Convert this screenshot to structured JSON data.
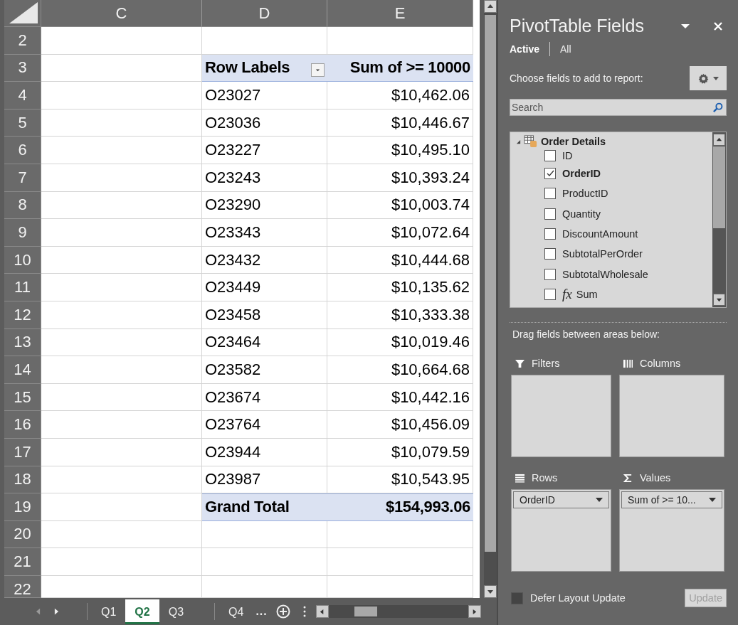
{
  "sheet": {
    "columns": [
      "C",
      "D",
      "E"
    ],
    "rows": [
      {
        "number": "2",
        "kind": "blank"
      },
      {
        "number": "3",
        "kind": "header",
        "label": "Row Labels",
        "value": "Sum of >= 10000"
      },
      {
        "number": "4",
        "kind": "item",
        "label": "O23027",
        "value": "$10,462.06"
      },
      {
        "number": "5",
        "kind": "item",
        "label": "O23036",
        "value": "$10,446.67"
      },
      {
        "number": "6",
        "kind": "item",
        "label": "O23227",
        "value": "$10,495.10"
      },
      {
        "number": "7",
        "kind": "item",
        "label": "O23243",
        "value": "$10,393.24"
      },
      {
        "number": "8",
        "kind": "item",
        "label": "O23290",
        "value": "$10,003.74"
      },
      {
        "number": "9",
        "kind": "item",
        "label": "O23343",
        "value": "$10,072.64"
      },
      {
        "number": "10",
        "kind": "item",
        "label": "O23432",
        "value": "$10,444.68"
      },
      {
        "number": "11",
        "kind": "item",
        "label": "O23449",
        "value": "$10,135.62"
      },
      {
        "number": "12",
        "kind": "item",
        "label": "O23458",
        "value": "$10,333.38"
      },
      {
        "number": "13",
        "kind": "item",
        "label": "O23464",
        "value": "$10,019.46"
      },
      {
        "number": "14",
        "kind": "item",
        "label": "O23582",
        "value": "$10,664.68"
      },
      {
        "number": "15",
        "kind": "item",
        "label": "O23674",
        "value": "$10,442.16"
      },
      {
        "number": "16",
        "kind": "item",
        "label": "O23764",
        "value": "$10,456.09"
      },
      {
        "number": "17",
        "kind": "item",
        "label": "O23944",
        "value": "$10,079.59"
      },
      {
        "number": "18",
        "kind": "item",
        "label": "O23987",
        "value": "$10,543.95"
      },
      {
        "number": "19",
        "kind": "total",
        "label": "Grand Total",
        "value": "$154,993.06"
      },
      {
        "number": "20",
        "kind": "blank"
      },
      {
        "number": "21",
        "kind": "blank"
      },
      {
        "number": "22",
        "kind": "blank"
      }
    ],
    "tabs": [
      {
        "label": "Q1",
        "selected": false
      },
      {
        "label": "Q2",
        "selected": true
      },
      {
        "label": "Q3",
        "selected": false
      },
      {
        "label": "Q4",
        "selected": false
      }
    ],
    "more_tabs": "..."
  },
  "pane": {
    "title": "PivotTable Fields",
    "tabs": [
      {
        "label": "Active",
        "selected": true
      },
      {
        "label": "All",
        "selected": false
      }
    ],
    "prompt": "Choose fields to add to report:",
    "search": {
      "placeholder": "Search"
    },
    "table": {
      "label": "Order Details",
      "expanded": true,
      "fields": [
        {
          "label": "ID",
          "checked": false,
          "kind": "field"
        },
        {
          "label": "OrderID",
          "checked": true,
          "kind": "field"
        },
        {
          "label": "ProductID",
          "checked": false,
          "kind": "field"
        },
        {
          "label": "Quantity",
          "checked": false,
          "kind": "field"
        },
        {
          "label": "DiscountAmount",
          "checked": false,
          "kind": "field"
        },
        {
          "label": "SubtotalPerOrder",
          "checked": false,
          "kind": "field"
        },
        {
          "label": "SubtotalWholesale",
          "checked": false,
          "kind": "field"
        },
        {
          "label": "Sum",
          "checked": false,
          "kind": "calculated",
          "symbol": "fx"
        }
      ]
    },
    "areas_hint": "Drag fields between areas below:",
    "areas": [
      {
        "kind": "filters",
        "label": "Filters"
      },
      {
        "kind": "columns",
        "label": "Columns"
      },
      {
        "kind": "rows",
        "label": "Rows",
        "items": [
          "OrderID"
        ]
      },
      {
        "kind": "values",
        "label": "Values",
        "items": [
          "Sum of >= 10..."
        ]
      }
    ],
    "defer": {
      "label": "Defer Layout Update",
      "checked": false
    },
    "update": {
      "label": "Update",
      "disabled": true
    }
  }
}
